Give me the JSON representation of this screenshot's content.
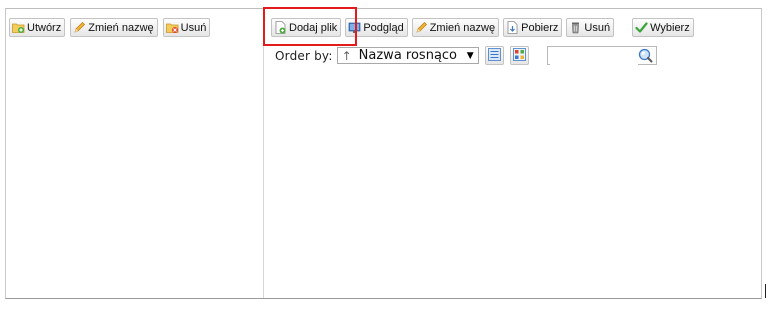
{
  "tree_toolbar": {
    "buttons": [
      {
        "label": "Utwórz",
        "icon": "folder-add-icon"
      },
      {
        "label": "Zmień nazwę",
        "icon": "pencil-icon"
      },
      {
        "label": "Usuń",
        "icon": "folder-delete-icon"
      }
    ]
  },
  "file_toolbar": {
    "buttons": [
      {
        "label": "Dodaj plik",
        "icon": "file-add-icon"
      },
      {
        "label": "Podgląd",
        "icon": "preview-icon"
      },
      {
        "label": "Zmień nazwę",
        "icon": "pencil-icon"
      },
      {
        "label": "Pobierz",
        "icon": "download-icon"
      },
      {
        "label": "Usuń",
        "icon": "trash-icon"
      },
      {
        "label": "Wybierz",
        "icon": "checkmark-icon"
      }
    ]
  },
  "order": {
    "label": "Order by:",
    "direction_icon": "↑",
    "selected": "Nazwa rosnąco"
  },
  "view_modes": [
    "list-view-icon",
    "thumbnail-view-icon"
  ],
  "search": {
    "value": "",
    "placeholder": ""
  },
  "colors": {
    "highlight": "#e31b1b",
    "folder": "#e8b93a",
    "accent_blue": "#3c78c8",
    "green_check": "#3aa33a"
  }
}
